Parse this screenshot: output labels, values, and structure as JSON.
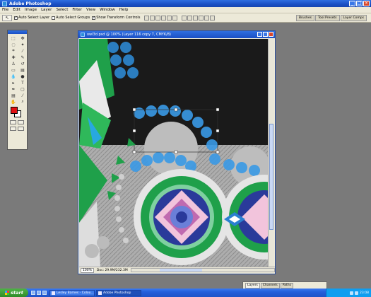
{
  "app": {
    "title": "Adobe Photoshop"
  },
  "window_controls": {
    "minimize": "_",
    "maximize": "□",
    "close": "×"
  },
  "menu": [
    "File",
    "Edit",
    "Image",
    "Layer",
    "Select",
    "Filter",
    "View",
    "Window",
    "Help"
  ],
  "options_bar": {
    "tool_glyph": "↖",
    "auto_select_layer": {
      "label": "Auto Select Layer",
      "checked": true
    },
    "auto_select_groups": {
      "label": "Auto Select Groups",
      "checked": false
    },
    "show_transform": {
      "label": "Show Transform Controls",
      "checked": true
    }
  },
  "palette_well": [
    "Brushes",
    "Tool Presets",
    "Layer Comps"
  ],
  "document": {
    "title": "owl3d.psd @ 100% (Layer 116 copy 7, CMYK/8)",
    "zoom": "100%",
    "doc_info": "Doc: 29.9M/232.3M"
  },
  "layers_palette": {
    "tabs": [
      "Layers",
      "Channels",
      "Paths"
    ]
  },
  "taskbar": {
    "start_label": "start",
    "tasks": [
      "Lesley Barnes - Colou...",
      "Adobe Photoshop"
    ],
    "clock": "23:08"
  },
  "colors": {
    "canvas_dark": "#1a1a1a",
    "green": "#1fa04a",
    "blue_dot": "#2f8fdc",
    "foreground": "#e01010",
    "titlebar": "#1a4fc4"
  }
}
